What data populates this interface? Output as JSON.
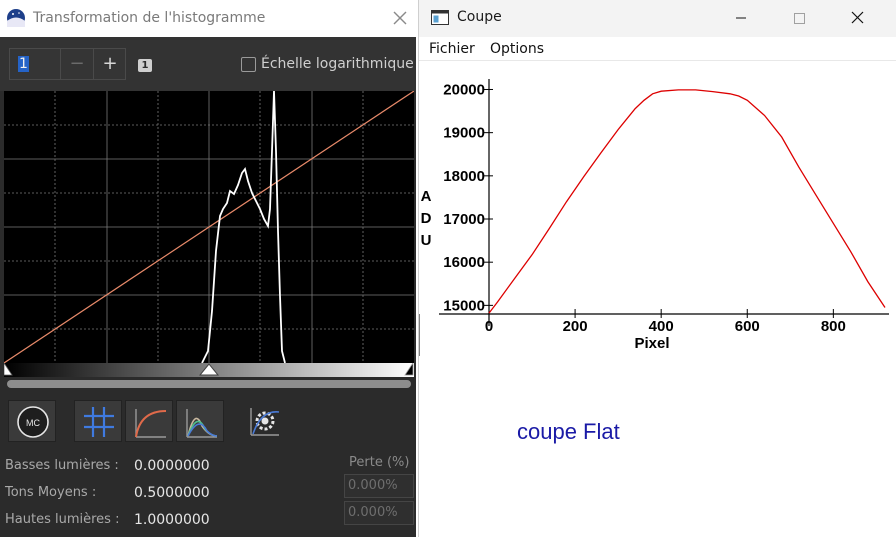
{
  "left": {
    "title": "Transformation de l'histogramme",
    "spin_value": "1",
    "spin_minus": "−",
    "spin_plus": "+",
    "channel_badge": "1",
    "log_label": "Échelle logarithmique",
    "tools": {
      "mc_label": "MC"
    },
    "params": {
      "shadows_label": "Basses lumières :",
      "shadows_value": "0.0000000",
      "midtones_label": "Tons Moyens :",
      "midtones_value": "0.5000000",
      "highlights_label": "Hautes lumières :",
      "highlights_value": "1.0000000",
      "loss_title": "Perte (%)",
      "loss_shadows": "0.000%",
      "loss_highlights": "0.000%"
    },
    "histogram_transfer": {
      "shadows": 0.0,
      "midtones": 0.5,
      "highlights": 1.0
    },
    "colors": {
      "curve": "#e88a6a",
      "histogram": "#ffffff",
      "grid": "#7a7a7a"
    }
  },
  "right": {
    "title": "Coupe",
    "menu": [
      "Fichier",
      "Options"
    ],
    "caption": "coupe Flat"
  },
  "chart_data": {
    "type": "line",
    "title": "",
    "xlabel": "Pixel",
    "ylabel": "ADU",
    "xlim": [
      0,
      920
    ],
    "ylim": [
      14800,
      20150
    ],
    "x_ticks": [
      0,
      200,
      400,
      600,
      800
    ],
    "y_ticks": [
      15000,
      16000,
      17000,
      18000,
      19000,
      20000
    ],
    "color": "#dd0000",
    "x": [
      0,
      20,
      60,
      100,
      140,
      180,
      220,
      260,
      300,
      340,
      360,
      380,
      400,
      440,
      480,
      520,
      560,
      580,
      600,
      640,
      680,
      720,
      760,
      800,
      840,
      880,
      920
    ],
    "y": [
      14820,
      15080,
      15630,
      16170,
      16780,
      17400,
      17980,
      18530,
      19070,
      19560,
      19750,
      19900,
      19960,
      19990,
      19990,
      19950,
      19900,
      19850,
      19750,
      19400,
      18900,
      18200,
      17550,
      16900,
      16250,
      15550,
      14950
    ]
  }
}
